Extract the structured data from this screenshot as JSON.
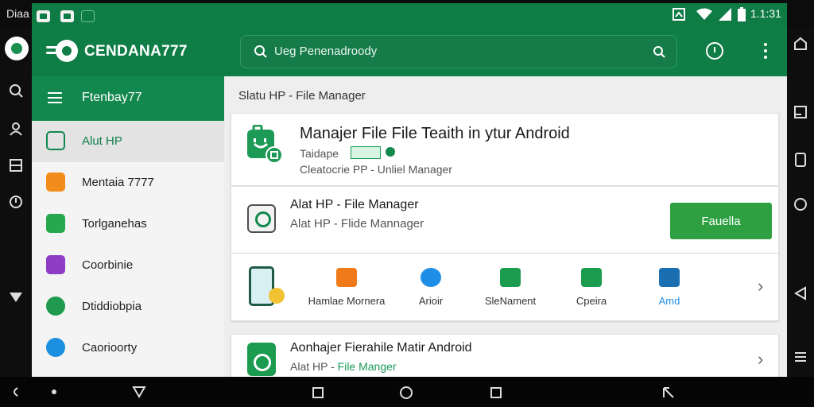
{
  "status_bar": {
    "left_label": "Diaa",
    "clock": "1.1:31"
  },
  "app_bar": {
    "title": "CENDANA777",
    "search_value": "Ueg Penenadroody"
  },
  "sidebar": {
    "title": "Ftenbay77",
    "items": [
      {
        "label": "Alut HP",
        "icon": "folder-icon",
        "color": "#13884e",
        "active": true
      },
      {
        "label": "Mentaia 7777",
        "icon": "folder-icon",
        "color": "#f28c1b",
        "active": false
      },
      {
        "label": "Torlganehas",
        "icon": "download-icon",
        "color": "#27a84e",
        "active": false
      },
      {
        "label": "Coorbinie",
        "icon": "image-icon",
        "color": "#8e3dc7",
        "active": false
      },
      {
        "label": "Dtiddiobpia",
        "icon": "disc-icon",
        "color": "#1f9a4f",
        "active": false
      },
      {
        "label": "Caorioorty",
        "icon": "cloud-icon",
        "color": "#1d8fe0",
        "active": false
      }
    ]
  },
  "main": {
    "breadcrumb": "Slatu HP - File Manager",
    "hero": {
      "title": "Manajer File File Teaith in ytur Android",
      "subtitle_1": "Taidape",
      "subtitle_2": "Cleatocrie PP - Unliel Manager"
    },
    "app_card": {
      "title": "Alat HP - File Manager",
      "subtitle": "Alat HP - Flide Mannager",
      "install_label": "Fauella"
    },
    "tools": [
      {
        "label": "Hamlae Mornera",
        "icon": "camera-icon",
        "color": "#f07a1a"
      },
      {
        "label": "Arioir",
        "icon": "chat-icon",
        "color": "#1e8ee6"
      },
      {
        "label": "SleNament",
        "icon": "gallery-icon",
        "color": "#1c9c4e"
      },
      {
        "label": "Cpeira",
        "icon": "briefcase-icon",
        "color": "#1c9c4e"
      },
      {
        "label": "Amd",
        "icon": "edit-icon",
        "color": "#1a6fb3",
        "label_color": "#1e8ee6"
      }
    ],
    "list_card": {
      "title": "Aonhajer Fierahile Matir Android",
      "subtitle_a": "Alat HP - ",
      "subtitle_b": "File Manger"
    }
  }
}
